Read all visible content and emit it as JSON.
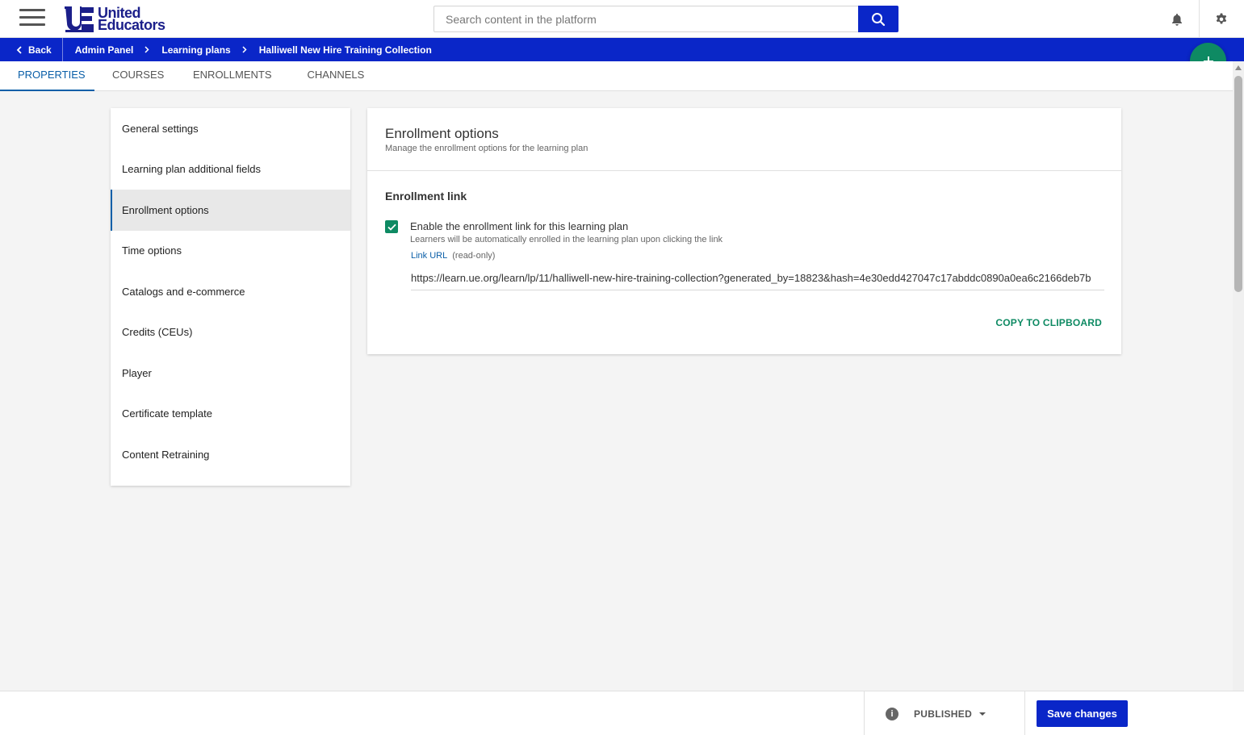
{
  "header": {
    "logo_line1": "United",
    "logo_line2": "Educators",
    "search_placeholder": "Search content in the platform",
    "icons": [
      "menu-icon",
      "search-icon",
      "bell-icon",
      "gear-icon"
    ]
  },
  "breadcrumb": {
    "back_label": "Back",
    "items": [
      "Admin Panel",
      "Learning plans",
      "Halliwell New Hire Training Collection"
    ]
  },
  "tabs": [
    "PROPERTIES",
    "COURSES",
    "ENROLLMENTS",
    "CHANNELS"
  ],
  "active_tab": "PROPERTIES",
  "sidebar": {
    "items": [
      "General settings",
      "Learning plan additional fields",
      "Enrollment options",
      "Time options",
      "Catalogs and e-commerce",
      "Credits (CEUs)",
      "Player",
      "Certificate template",
      "Content Retraining"
    ],
    "active": "Enrollment options"
  },
  "card": {
    "title": "Enrollment options",
    "subtitle": "Manage the enrollment options for the learning plan",
    "section_title": "Enrollment link",
    "checkbox_label": "Enable the enrollment link for this learning plan",
    "checkbox_checked": true,
    "checkbox_sub": "Learners will be automatically enrolled in the learning plan upon clicking the link",
    "link_label": "Link URL",
    "link_readonly": "(read-only)",
    "link_url": "https://learn.ue.org/learn/lp/11/halliwell-new-hire-training-collection?generated_by=18823&hash=4e30edd427047c17abddc0890a0ea6c2166deb7b",
    "copy_label": "COPY TO CLIPBOARD"
  },
  "footer": {
    "status_label": "PUBLISHED",
    "save_label": "Save changes"
  },
  "colors": {
    "brand_blue": "#0a26c8",
    "accent_green": "#0e8a63",
    "tab_active": "#0b5fa8"
  }
}
